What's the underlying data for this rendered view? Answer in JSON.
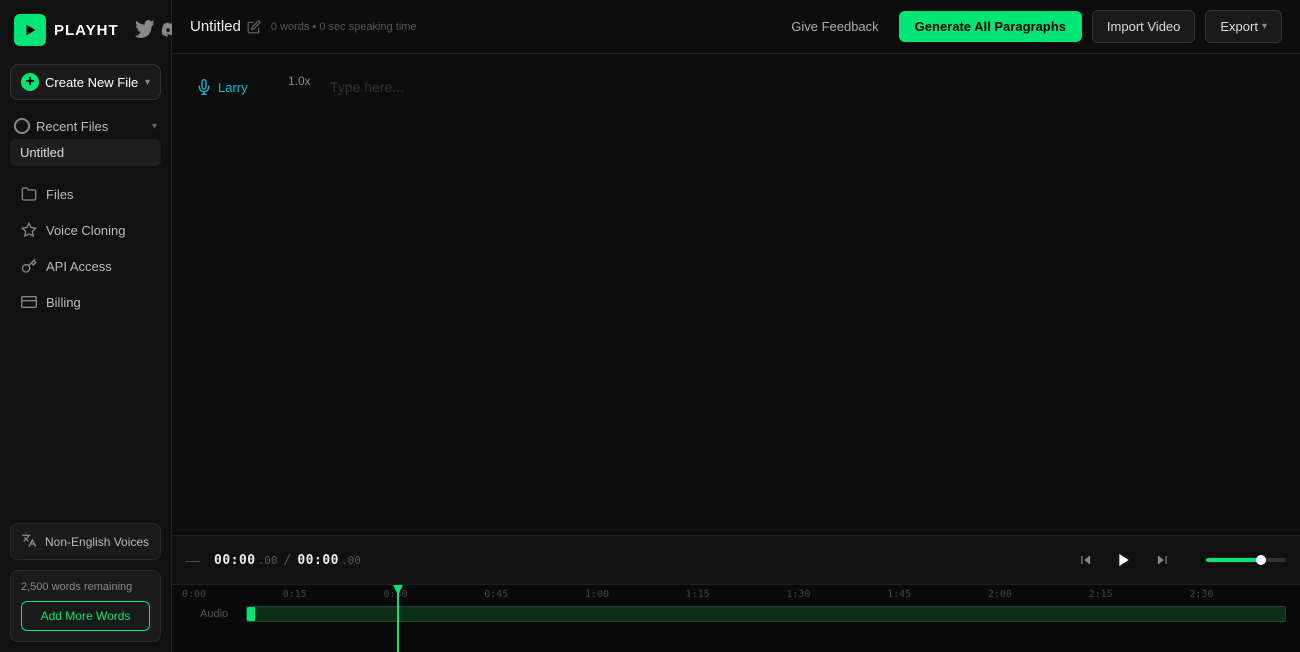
{
  "app": {
    "logo_label": "PLAYHT",
    "logo_icon": "▶",
    "brand_color": "#00e676"
  },
  "sidebar": {
    "create_button": "Create New File",
    "recent_files_label": "Recent Files",
    "recent_items": [
      {
        "label": "Untitled"
      }
    ],
    "nav_items": [
      {
        "label": "Files",
        "icon": "folder"
      },
      {
        "label": "Voice Cloning",
        "icon": "sparkle"
      },
      {
        "label": "API Access",
        "icon": "key"
      },
      {
        "label": "Billing",
        "icon": "card"
      }
    ],
    "non_english_label": "Non-English Voices",
    "words_remaining": "2,500 words remaining",
    "add_words_btn": "Add More Words"
  },
  "topbar": {
    "file_title": "Untitled",
    "file_meta": "0 words • 0 sec speaking time",
    "feedback_btn": "Give Feedback",
    "generate_btn": "Generate All Paragraphs",
    "import_btn": "Import Video",
    "export_btn": "Export"
  },
  "editor": {
    "voice_name": "Larry",
    "speed_label": "1.0x",
    "placeholder": "Type here..."
  },
  "transport": {
    "dash": "—",
    "time_current_main": "00:00",
    "time_current_sub": ".00",
    "time_total_main": "00:00",
    "time_total_sub": ".00"
  },
  "timeline": {
    "audio_label": "Audio",
    "markers": [
      "0:00",
      "0:15",
      "0:30",
      "0:45",
      "1:00",
      "1:15",
      "1:30",
      "1:45",
      "2:00",
      "2:15",
      "2:30"
    ]
  }
}
